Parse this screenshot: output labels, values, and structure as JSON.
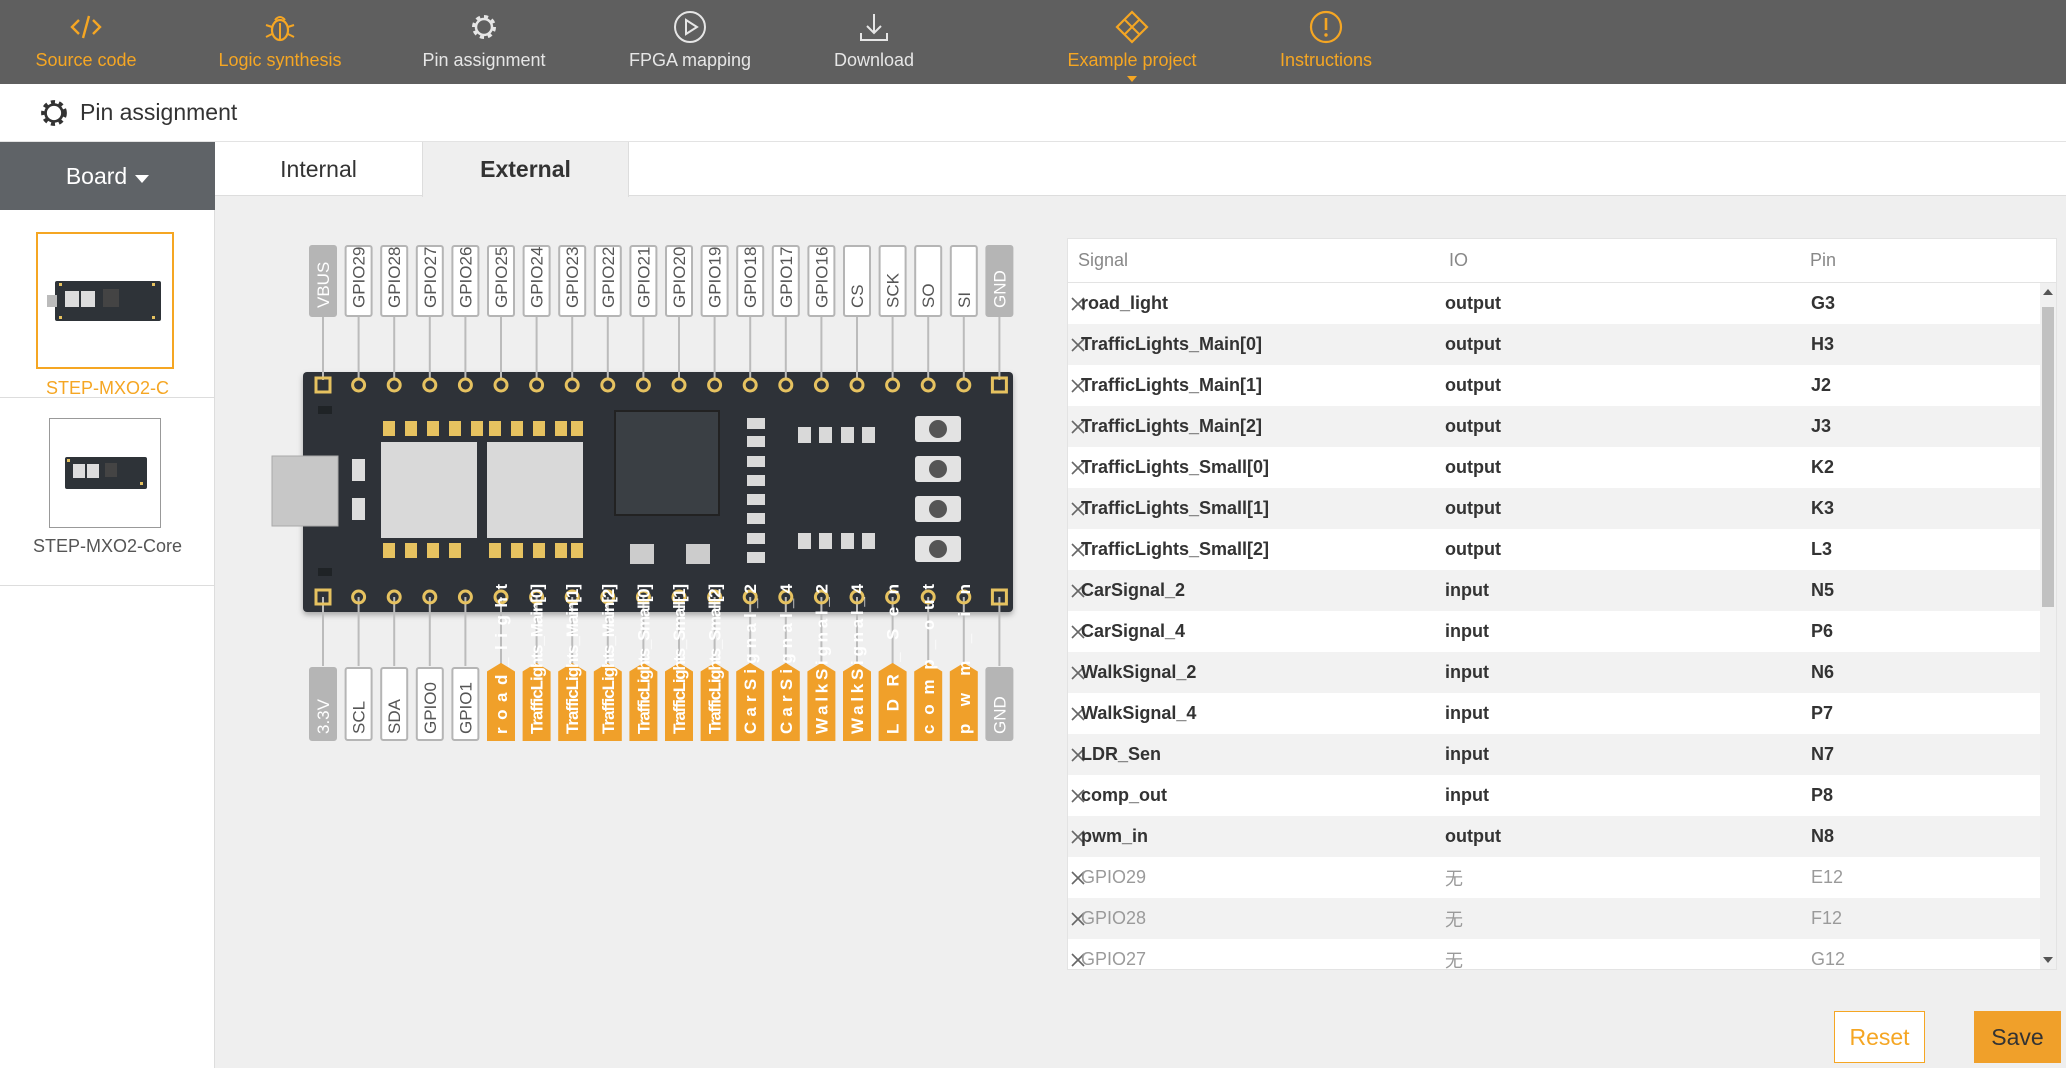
{
  "toolbar": {
    "items": [
      {
        "label": "Source code",
        "icon": "code-icon"
      },
      {
        "label": "Logic synthesis",
        "icon": "bug-icon"
      },
      {
        "label": "Pin assignment",
        "icon": "gear-icon"
      },
      {
        "label": "FPGA mapping",
        "icon": "play-icon"
      },
      {
        "label": "Download",
        "icon": "download-icon"
      },
      {
        "label": "Example project",
        "icon": "diamond-icon"
      },
      {
        "label": "Instructions",
        "icon": "warning-icon"
      }
    ]
  },
  "page": {
    "title": "Pin assignment"
  },
  "sidebar": {
    "header": "Board",
    "boards": [
      {
        "name": "STEP-MXO2-C",
        "selected": true
      },
      {
        "name": "STEP-MXO2-Core",
        "selected": false
      }
    ]
  },
  "tabs": [
    {
      "label": "Internal",
      "active": false
    },
    {
      "label": "External",
      "active": true
    }
  ],
  "board": {
    "top_pins": [
      "VBUS",
      "GPIO29",
      "GPIO28",
      "GPIO27",
      "GPIO26",
      "GPIO25",
      "GPIO24",
      "GPIO23",
      "GPIO22",
      "GPIO21",
      "GPIO20",
      "GPIO19",
      "GPIO18",
      "GPIO17",
      "GPIO16",
      "CS",
      "SCK",
      "SO",
      "SI",
      "GND"
    ],
    "bottom_pins": [
      {
        "label": "3.3V",
        "assigned": false,
        "gray": true
      },
      {
        "label": "SCL",
        "assigned": false
      },
      {
        "label": "SDA",
        "assigned": false
      },
      {
        "label": "GPIO0",
        "assigned": false
      },
      {
        "label": "GPIO1",
        "assigned": false
      },
      {
        "label": "road_light",
        "assigned": true
      },
      {
        "label": "TrafficLights_Main[0]",
        "assigned": true
      },
      {
        "label": "TrafficLights_Main[1]",
        "assigned": true
      },
      {
        "label": "TrafficLights_Main[2]",
        "assigned": true
      },
      {
        "label": "TrafficLights_Small[0]",
        "assigned": true
      },
      {
        "label": "TrafficLights_Small[1]",
        "assigned": true
      },
      {
        "label": "TrafficLights_Small[2]",
        "assigned": true
      },
      {
        "label": "CarSignal_2",
        "assigned": true
      },
      {
        "label": "CarSignal_4",
        "assigned": true
      },
      {
        "label": "WalkSignal_2",
        "assigned": true
      },
      {
        "label": "WalkSignal_4",
        "assigned": true
      },
      {
        "label": "LDR_Sen",
        "assigned": true
      },
      {
        "label": "comp_out",
        "assigned": true
      },
      {
        "label": "pwm_in",
        "assigned": true
      },
      {
        "label": "GND",
        "assigned": false,
        "gray": true
      }
    ]
  },
  "table": {
    "headers": {
      "signal": "Signal",
      "io": "IO",
      "pin": "Pin"
    },
    "rows": [
      {
        "signal": "road_light",
        "io": "output",
        "pin": "G3",
        "assigned": true
      },
      {
        "signal": "TrafficLights_Main[0]",
        "io": "output",
        "pin": "H3",
        "assigned": true
      },
      {
        "signal": "TrafficLights_Main[1]",
        "io": "output",
        "pin": "J2",
        "assigned": true
      },
      {
        "signal": "TrafficLights_Main[2]",
        "io": "output",
        "pin": "J3",
        "assigned": true
      },
      {
        "signal": "TrafficLights_Small[0]",
        "io": "output",
        "pin": "K2",
        "assigned": true
      },
      {
        "signal": "TrafficLights_Small[1]",
        "io": "output",
        "pin": "K3",
        "assigned": true
      },
      {
        "signal": "TrafficLights_Small[2]",
        "io": "output",
        "pin": "L3",
        "assigned": true
      },
      {
        "signal": "CarSignal_2",
        "io": "input",
        "pin": "N5",
        "assigned": true
      },
      {
        "signal": "CarSignal_4",
        "io": "input",
        "pin": "P6",
        "assigned": true
      },
      {
        "signal": "WalkSignal_2",
        "io": "input",
        "pin": "N6",
        "assigned": true
      },
      {
        "signal": "WalkSignal_4",
        "io": "input",
        "pin": "P7",
        "assigned": true
      },
      {
        "signal": "LDR_Sen",
        "io": "input",
        "pin": "N7",
        "assigned": true
      },
      {
        "signal": "comp_out",
        "io": "input",
        "pin": "P8",
        "assigned": true
      },
      {
        "signal": "pwm_in",
        "io": "output",
        "pin": "N8",
        "assigned": true
      },
      {
        "signal": "GPIO29",
        "io": "无",
        "pin": "E12",
        "assigned": false
      },
      {
        "signal": "GPIO28",
        "io": "无",
        "pin": "F12",
        "assigned": false
      },
      {
        "signal": "GPIO27",
        "io": "无",
        "pin": "G12",
        "assigned": false
      }
    ]
  },
  "buttons": {
    "reset": "Reset",
    "save": "Save"
  },
  "colors": {
    "accent": "#f5a623",
    "toolbar_bg": "#5f5f5f",
    "board_bg": "#2e3338",
    "pad_gold": "#e6c260",
    "pin_gray": "#b5b5b5"
  }
}
